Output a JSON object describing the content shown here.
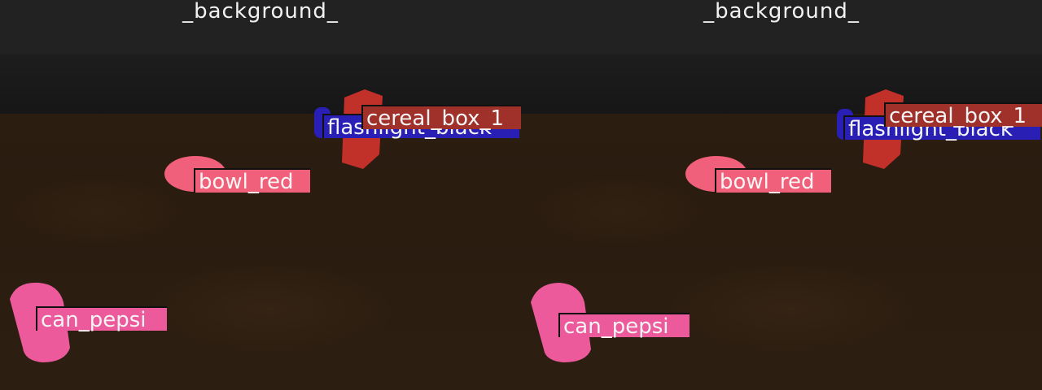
{
  "panels": [
    {
      "background_label": "_background_",
      "objects": [
        {
          "label": "can_pepsi",
          "color": "#ec5a9c"
        },
        {
          "label": "bowl_red",
          "color": "#f0607a"
        },
        {
          "label": "flashlight_black",
          "color": "#2a1fb5"
        },
        {
          "label": "cereal_box_1",
          "color": "#a0302a"
        }
      ]
    },
    {
      "background_label": "_background_",
      "objects": [
        {
          "label": "can_pepsi",
          "color": "#ec5a9c"
        },
        {
          "label": "bowl_red",
          "color": "#f0607a"
        },
        {
          "label": "flashlight_black",
          "color": "#2a1fb5"
        },
        {
          "label": "cereal_box_1",
          "color": "#a0302a"
        }
      ]
    }
  ]
}
